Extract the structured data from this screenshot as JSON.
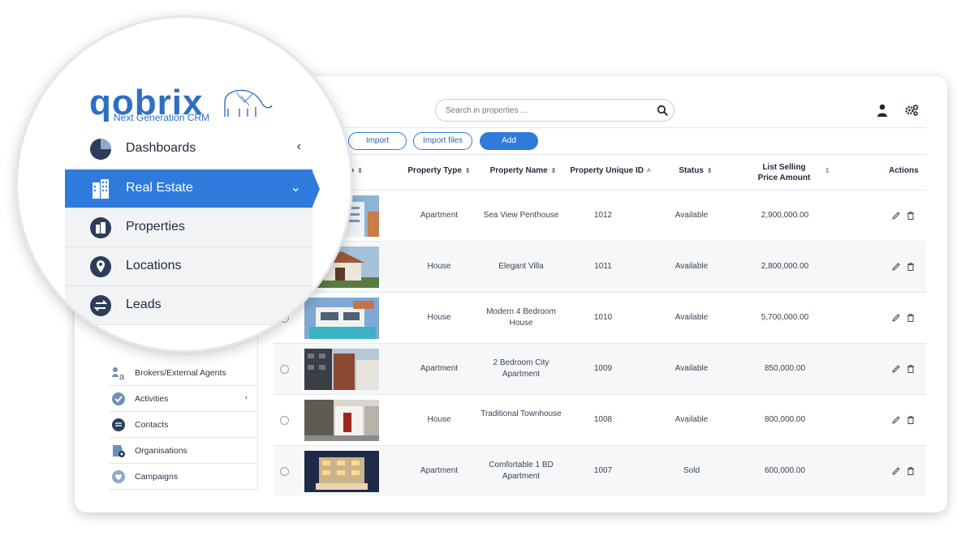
{
  "brand": {
    "name": "qobrix",
    "tagline": "Next Generation CRM",
    "color": "#2e6ec6"
  },
  "search": {
    "placeholder": "Search in properties ..."
  },
  "toolbar": {
    "import_label": "Import",
    "import_files_label": "Import files",
    "add_label": "Add"
  },
  "menu_magnified": [
    {
      "label": "Dashboards",
      "icon": "pie-chart-icon",
      "chevron": "‹"
    },
    {
      "label": "Real Estate",
      "icon": "building-icon",
      "chevron": "⌄",
      "active": true
    },
    {
      "label": "Properties",
      "icon": "city-icon"
    },
    {
      "label": "Locations",
      "icon": "map-pin-icon"
    },
    {
      "label": "Leads",
      "icon": "exchange-icon"
    }
  ],
  "sidebar": {
    "items": [
      {
        "label": "Brokers/External Agents",
        "icon": "brokers-icon"
      },
      {
        "label": "Activities",
        "icon": "check-circle-icon",
        "chevron": "‹"
      },
      {
        "label": "Contacts",
        "icon": "chat-icon"
      },
      {
        "label": "Organisations",
        "icon": "organisation-icon"
      },
      {
        "label": "Campaigns",
        "icon": "heart-icon"
      }
    ]
  },
  "table": {
    "columns": [
      "Property Type",
      "Property Name",
      "Property Unique ID",
      "Status",
      "List Selling Price Amount",
      "Actions"
    ],
    "rows": [
      {
        "type": "Apartment",
        "name": "Sea View Penthouse",
        "id": "1012",
        "status": "Available",
        "price": "2,900,000.00"
      },
      {
        "type": "House",
        "name": "Elegant Villa",
        "id": "1011",
        "status": "Available",
        "price": "2,800,000.00"
      },
      {
        "type": "House",
        "name": "Modern 4 Bedroom House",
        "id": "1010",
        "status": "Available",
        "price": "5,700,000.00"
      },
      {
        "type": "Apartment",
        "name": "2 Bedroom City Apartment",
        "id": "1009",
        "status": "Available",
        "price": "850,000.00"
      },
      {
        "type": "House",
        "name": "Traditional Townhouse",
        "id": "1008",
        "status": "Available",
        "price": "800,000.00"
      },
      {
        "type": "Apartment",
        "name": "Comfortable 1 BD Apartment",
        "id": "1007",
        "status": "Sold",
        "price": "600,000.00"
      }
    ]
  },
  "colors": {
    "accent": "#2f7bdc",
    "text": "#1d2a3a"
  }
}
